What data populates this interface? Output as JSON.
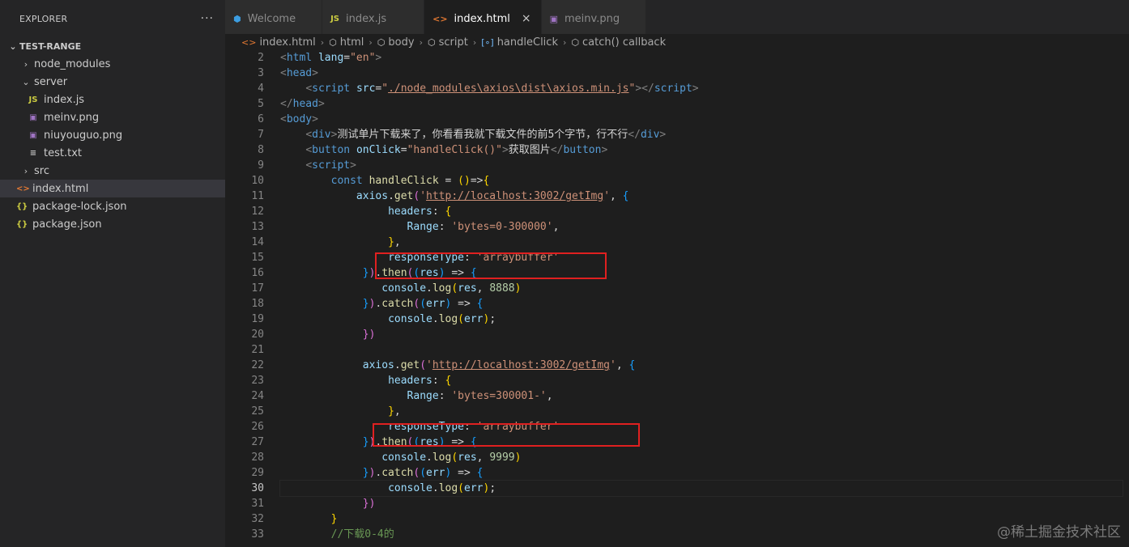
{
  "explorer": {
    "title": "EXPLORER",
    "more": "···",
    "root": "TEST-RANGE",
    "items": [
      {
        "label": "node_modules",
        "kind": "folder",
        "chevron": "›"
      },
      {
        "label": "server",
        "kind": "folder-open",
        "chevron": "⌄"
      },
      {
        "label": "index.js",
        "kind": "js",
        "icon": "JS"
      },
      {
        "label": "meinv.png",
        "kind": "png",
        "icon": "▣"
      },
      {
        "label": "niuyouguo.png",
        "kind": "png",
        "icon": "▣"
      },
      {
        "label": "test.txt",
        "kind": "txt",
        "icon": "≡"
      },
      {
        "label": "src",
        "kind": "folder",
        "chevron": "›"
      },
      {
        "label": "index.html",
        "kind": "html",
        "icon": "<>"
      },
      {
        "label": "package-lock.json",
        "kind": "json",
        "icon": "{}"
      },
      {
        "label": "package.json",
        "kind": "json",
        "icon": "{}"
      }
    ]
  },
  "tabs": [
    {
      "label": "Welcome",
      "icon": "⬢"
    },
    {
      "label": "index.js",
      "icon": "JS"
    },
    {
      "label": "index.html",
      "icon": "<>",
      "close": "×"
    },
    {
      "label": "meinv.png",
      "icon": "▣"
    }
  ],
  "breadcrumb": [
    {
      "label": "index.html",
      "icon": "<>"
    },
    {
      "label": "html",
      "icon": "⬡"
    },
    {
      "label": "body",
      "icon": "⬡"
    },
    {
      "label": "script",
      "icon": "⬡"
    },
    {
      "label": "handleClick",
      "icon": "[∘]"
    },
    {
      "label": "catch() callback",
      "icon": "⬡"
    }
  ],
  "editor": {
    "current_line": 30,
    "lines": [
      {
        "n": 2,
        "t": [
          [
            "<",
            "br"
          ],
          [
            "html",
            "tg"
          ],
          [
            " ",
            ""
          ],
          [
            "lang",
            "at"
          ],
          [
            "=",
            ""
          ],
          [
            "\"en\"",
            "st"
          ],
          [
            ">",
            "br"
          ]
        ]
      },
      {
        "n": 3,
        "t": [
          [
            "<",
            "br"
          ],
          [
            "head",
            "tg"
          ],
          [
            ">",
            "br"
          ]
        ]
      },
      {
        "n": 4,
        "t": [
          [
            "    ",
            ""
          ],
          [
            "<",
            "br"
          ],
          [
            "script",
            "tg"
          ],
          [
            " ",
            ""
          ],
          [
            "src",
            "at"
          ],
          [
            "=",
            ""
          ],
          [
            "\"",
            "st"
          ],
          [
            "./node_modules\\axios\\dist\\axios.min.js",
            "st ul"
          ],
          [
            "\"",
            "st"
          ],
          [
            "></",
            "br"
          ],
          [
            "script",
            "tg"
          ],
          [
            ">",
            "br"
          ]
        ]
      },
      {
        "n": 5,
        "t": [
          [
            "</",
            "br"
          ],
          [
            "head",
            "tg"
          ],
          [
            ">",
            "br"
          ]
        ]
      },
      {
        "n": 6,
        "t": [
          [
            "<",
            "br"
          ],
          [
            "body",
            "tg"
          ],
          [
            ">",
            "br"
          ]
        ]
      },
      {
        "n": 7,
        "t": [
          [
            "    ",
            ""
          ],
          [
            "<",
            "br"
          ],
          [
            "div",
            "tg"
          ],
          [
            ">",
            "br"
          ],
          [
            "测试单片下载来了，你看看我就下载文件的前5个字节，行不行",
            ""
          ],
          [
            "</",
            "br"
          ],
          [
            "div",
            "tg"
          ],
          [
            ">",
            "br"
          ]
        ]
      },
      {
        "n": 8,
        "t": [
          [
            "    ",
            ""
          ],
          [
            "<",
            "br"
          ],
          [
            "button",
            "tg"
          ],
          [
            " ",
            ""
          ],
          [
            "onClick",
            "at"
          ],
          [
            "=",
            ""
          ],
          [
            "\"handleClick()\"",
            "st"
          ],
          [
            ">",
            "br"
          ],
          [
            "获取图片",
            ""
          ],
          [
            "</",
            "br"
          ],
          [
            "button",
            "tg"
          ],
          [
            ">",
            "br"
          ]
        ]
      },
      {
        "n": 9,
        "t": [
          [
            "    ",
            ""
          ],
          [
            "<",
            "br"
          ],
          [
            "script",
            "tg"
          ],
          [
            ">",
            "br"
          ]
        ]
      },
      {
        "n": 10,
        "t": [
          [
            "        ",
            ""
          ],
          [
            "const",
            "kw"
          ],
          [
            " ",
            ""
          ],
          [
            "handleClick",
            "fn"
          ],
          [
            " = ",
            ""
          ],
          [
            "()",
            "b1"
          ],
          [
            "=>",
            ""
          ],
          [
            "{",
            "b1"
          ]
        ]
      },
      {
        "n": 11,
        "t": [
          [
            "            ",
            ""
          ],
          [
            "axios",
            "pr"
          ],
          [
            ".",
            ""
          ],
          [
            "get",
            "fn"
          ],
          [
            "(",
            "b2"
          ],
          [
            "'",
            "st"
          ],
          [
            "http://localhost:3002/getImg",
            "st ul"
          ],
          [
            "'",
            "st"
          ],
          [
            ", ",
            ""
          ],
          [
            "{",
            "b3"
          ]
        ]
      },
      {
        "n": 12,
        "t": [
          [
            "                 ",
            ""
          ],
          [
            "headers",
            "pr"
          ],
          [
            ": ",
            ""
          ],
          [
            "{",
            "b1"
          ]
        ]
      },
      {
        "n": 13,
        "t": [
          [
            "                    ",
            ""
          ],
          [
            "Range",
            "pr"
          ],
          [
            ": ",
            ""
          ],
          [
            "'bytes=0-300000'",
            "st"
          ],
          [
            ",",
            ""
          ]
        ]
      },
      {
        "n": 14,
        "t": [
          [
            "                 ",
            ""
          ],
          [
            "}",
            "b1"
          ],
          [
            ",",
            ""
          ]
        ]
      },
      {
        "n": 15,
        "t": [
          [
            "                 ",
            ""
          ],
          [
            "responseType",
            "pr"
          ],
          [
            ": ",
            ""
          ],
          [
            "'arraybuffer'",
            "st"
          ]
        ]
      },
      {
        "n": 16,
        "t": [
          [
            "             ",
            ""
          ],
          [
            "}",
            "b3"
          ],
          [
            ")",
            "b2"
          ],
          [
            ".",
            ""
          ],
          [
            "then",
            "fn"
          ],
          [
            "(",
            "b2"
          ],
          [
            "(",
            "b3"
          ],
          [
            "res",
            "pr"
          ],
          [
            ")",
            "b3"
          ],
          [
            " => ",
            ""
          ],
          [
            "{",
            "b3"
          ]
        ]
      },
      {
        "n": 17,
        "t": [
          [
            "                ",
            ""
          ],
          [
            "console",
            "pr"
          ],
          [
            ".",
            ""
          ],
          [
            "log",
            "fn"
          ],
          [
            "(",
            "b1"
          ],
          [
            "res",
            "pr"
          ],
          [
            ", ",
            ""
          ],
          [
            "8888",
            "nm"
          ],
          [
            ")",
            "b1"
          ]
        ]
      },
      {
        "n": 18,
        "t": [
          [
            "             ",
            ""
          ],
          [
            "}",
            "b3"
          ],
          [
            ")",
            "b2"
          ],
          [
            ".",
            ""
          ],
          [
            "catch",
            "fn"
          ],
          [
            "(",
            "b2"
          ],
          [
            "(",
            "b3"
          ],
          [
            "err",
            "pr"
          ],
          [
            ")",
            "b3"
          ],
          [
            " => ",
            ""
          ],
          [
            "{",
            "b3"
          ]
        ]
      },
      {
        "n": 19,
        "t": [
          [
            "                 ",
            ""
          ],
          [
            "console",
            "pr"
          ],
          [
            ".",
            ""
          ],
          [
            "log",
            "fn"
          ],
          [
            "(",
            "b1"
          ],
          [
            "err",
            "pr"
          ],
          [
            ")",
            "b1"
          ],
          [
            ";",
            ""
          ]
        ]
      },
      {
        "n": 20,
        "t": [
          [
            "             ",
            ""
          ],
          [
            "})",
            "b2"
          ]
        ]
      },
      {
        "n": 21,
        "t": []
      },
      {
        "n": 22,
        "t": [
          [
            "             ",
            ""
          ],
          [
            "axios",
            "pr"
          ],
          [
            ".",
            ""
          ],
          [
            "get",
            "fn"
          ],
          [
            "(",
            "b2"
          ],
          [
            "'",
            "st"
          ],
          [
            "http://localhost:3002/getImg",
            "st ul"
          ],
          [
            "'",
            "st"
          ],
          [
            ", ",
            ""
          ],
          [
            "{",
            "b3"
          ]
        ]
      },
      {
        "n": 23,
        "t": [
          [
            "                 ",
            ""
          ],
          [
            "headers",
            "pr"
          ],
          [
            ": ",
            ""
          ],
          [
            "{",
            "b1"
          ]
        ]
      },
      {
        "n": 24,
        "t": [
          [
            "                    ",
            ""
          ],
          [
            "Range",
            "pr"
          ],
          [
            ": ",
            ""
          ],
          [
            "'bytes=300001-'",
            "st"
          ],
          [
            ",",
            ""
          ]
        ]
      },
      {
        "n": 25,
        "t": [
          [
            "                 ",
            ""
          ],
          [
            "}",
            "b1"
          ],
          [
            ",",
            ""
          ]
        ]
      },
      {
        "n": 26,
        "t": [
          [
            "                 ",
            ""
          ],
          [
            "responseType",
            "pr"
          ],
          [
            ": ",
            ""
          ],
          [
            "'arraybuffer'",
            "st"
          ]
        ]
      },
      {
        "n": 27,
        "t": [
          [
            "             ",
            ""
          ],
          [
            "}",
            "b3"
          ],
          [
            ")",
            "b2"
          ],
          [
            ".",
            ""
          ],
          [
            "then",
            "fn"
          ],
          [
            "(",
            "b2"
          ],
          [
            "(",
            "b3"
          ],
          [
            "res",
            "pr"
          ],
          [
            ")",
            "b3"
          ],
          [
            " => ",
            ""
          ],
          [
            "{",
            "b3"
          ]
        ]
      },
      {
        "n": 28,
        "t": [
          [
            "                ",
            ""
          ],
          [
            "console",
            "pr"
          ],
          [
            ".",
            ""
          ],
          [
            "log",
            "fn"
          ],
          [
            "(",
            "b1"
          ],
          [
            "res",
            "pr"
          ],
          [
            ", ",
            ""
          ],
          [
            "9999",
            "nm"
          ],
          [
            ")",
            "b1"
          ]
        ]
      },
      {
        "n": 29,
        "t": [
          [
            "             ",
            ""
          ],
          [
            "}",
            "b3"
          ],
          [
            ")",
            "b2"
          ],
          [
            ".",
            ""
          ],
          [
            "catch",
            "fn"
          ],
          [
            "(",
            "b2"
          ],
          [
            "(",
            "b3"
          ],
          [
            "err",
            "pr"
          ],
          [
            ")",
            "b3"
          ],
          [
            " => ",
            ""
          ],
          [
            "{",
            "b3"
          ]
        ]
      },
      {
        "n": 30,
        "t": [
          [
            "                 ",
            ""
          ],
          [
            "console",
            "pr"
          ],
          [
            ".",
            ""
          ],
          [
            "log",
            "fn"
          ],
          [
            "(",
            "b1"
          ],
          [
            "err",
            "pr"
          ],
          [
            ")",
            "b1"
          ],
          [
            ";",
            ""
          ]
        ]
      },
      {
        "n": 31,
        "t": [
          [
            "             ",
            ""
          ],
          [
            "})",
            "b2"
          ]
        ]
      },
      {
        "n": 32,
        "t": [
          [
            "        ",
            ""
          ],
          [
            "}",
            "b1"
          ]
        ]
      },
      {
        "n": 33,
        "t": [
          [
            "        ",
            ""
          ],
          [
            "//下载0-4的",
            "cm"
          ]
        ]
      }
    ]
  },
  "watermark": "@稀土掘金技术社区",
  "colors": {
    "highlight_box": "#e02020",
    "editor_bg": "#1e1e1e",
    "sidebar_bg": "#252526"
  }
}
